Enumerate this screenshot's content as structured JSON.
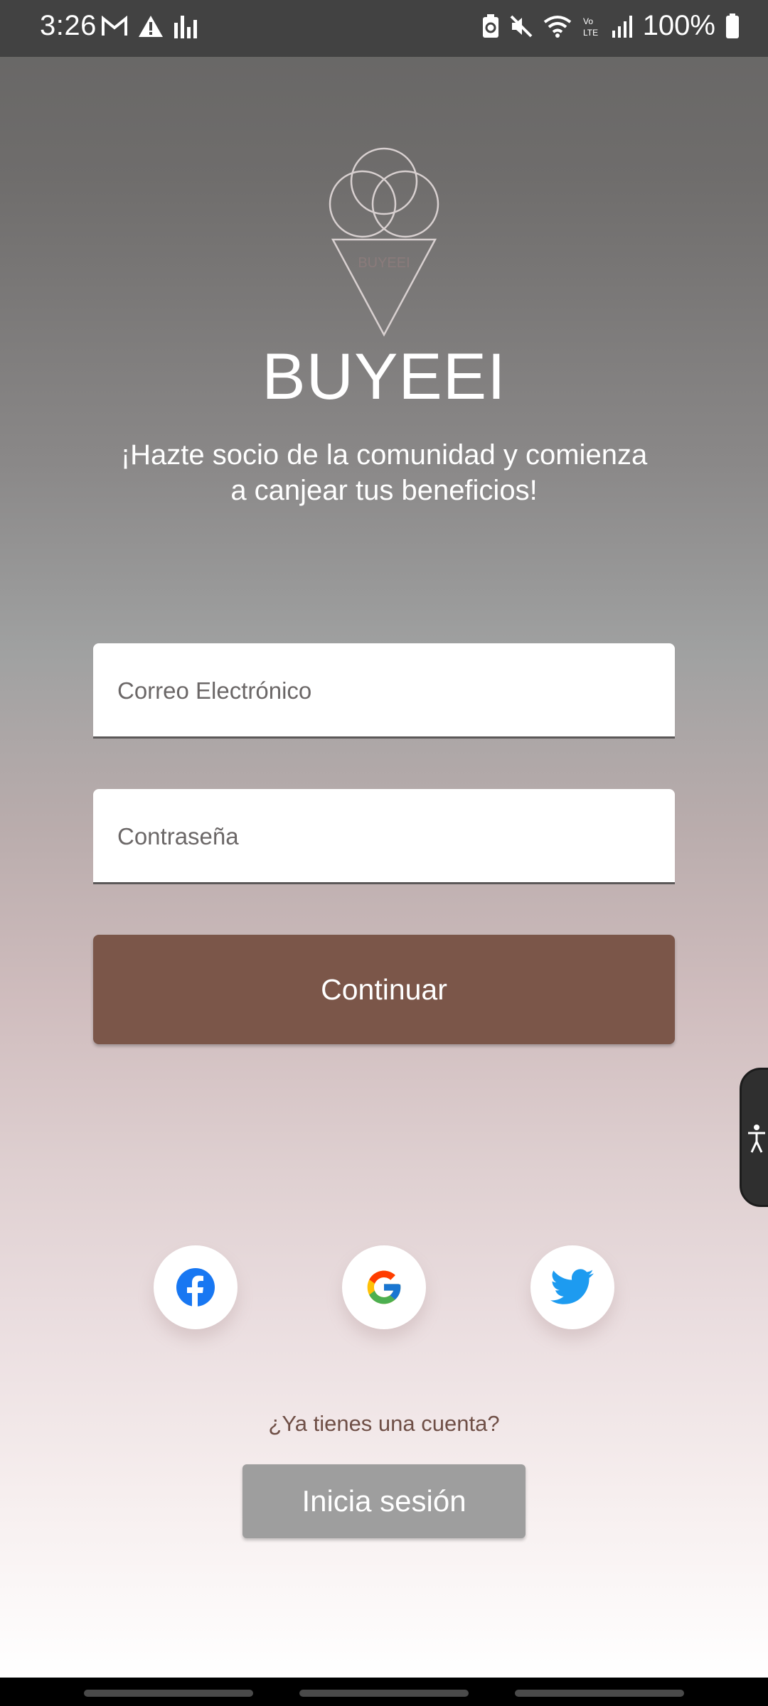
{
  "status_bar": {
    "time": "3:26",
    "left_icons": [
      "gmail-icon",
      "warning-icon",
      "signal-bars-icon"
    ],
    "right_icons": [
      "battery-saver-icon",
      "mute-icon",
      "wifi-icon",
      "volte-icon",
      "cell-signal-icon",
      "battery-icon"
    ],
    "battery": "100%"
  },
  "app": {
    "logo_text": "BUYEEI",
    "title": "BUYEEI",
    "tagline_line1": "¡Hazte socio de la comunidad y comienza",
    "tagline_line2": "a canjear tus beneficios!"
  },
  "form": {
    "email_placeholder": "Correo Electrónico",
    "email_value": "",
    "password_placeholder": "Contraseña",
    "password_value": "",
    "continue_label": "Continuar"
  },
  "social": {
    "buttons": [
      "facebook-icon",
      "google-icon",
      "twitter-icon"
    ]
  },
  "footer": {
    "have_account": "¿Ya tienes una cuenta?",
    "login_label": "Inicia sesión"
  },
  "colors": {
    "primary_button": "#7b5649",
    "secondary_button": "#9e9e9e",
    "link_text": "#6f4f46"
  }
}
